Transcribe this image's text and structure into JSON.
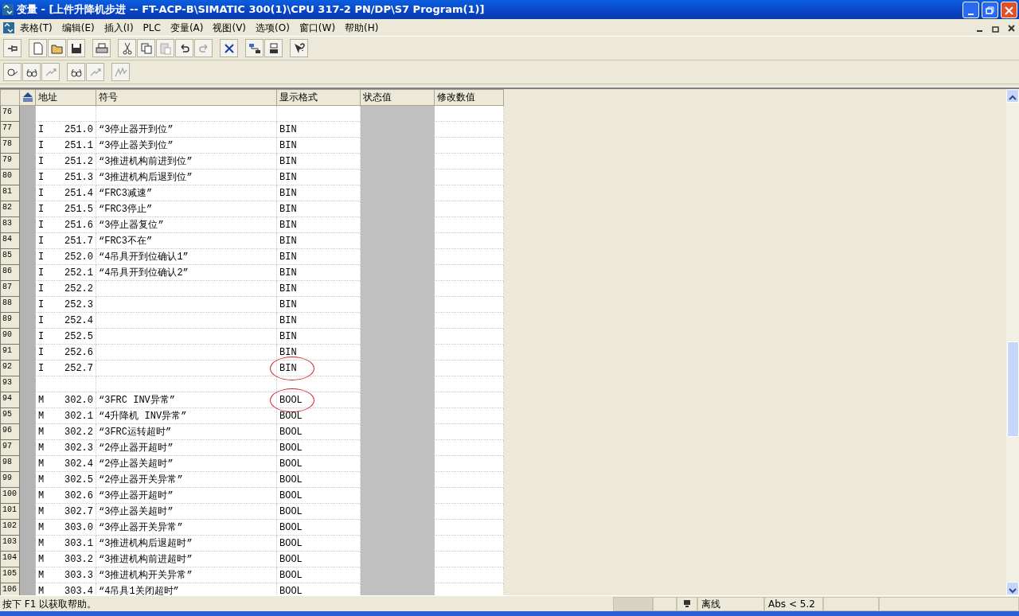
{
  "window": {
    "title": "变量 - [上件升降机步进 -- FT-ACP-B\\SIMATIC 300(1)\\CPU 317-2 PN/DP\\S7 Program(1)]"
  },
  "menu": [
    "表格(T)",
    "编辑(E)",
    "插入(I)",
    "PLC",
    "变量(A)",
    "视图(V)",
    "选项(O)",
    "窗口(W)",
    "帮助(H)"
  ],
  "toolbar1": [
    {
      "kind": "pin",
      "disabled": false
    },
    {
      "kind": "sep"
    },
    {
      "kind": "new",
      "disabled": false
    },
    {
      "kind": "open",
      "disabled": false
    },
    {
      "kind": "save",
      "disabled": false
    },
    {
      "kind": "sep"
    },
    {
      "kind": "print",
      "disabled": false
    },
    {
      "kind": "sep"
    },
    {
      "kind": "cut",
      "disabled": false
    },
    {
      "kind": "copy",
      "disabled": false
    },
    {
      "kind": "paste",
      "disabled": true
    },
    {
      "kind": "undo",
      "disabled": false
    },
    {
      "kind": "redo",
      "disabled": true
    },
    {
      "kind": "sep"
    },
    {
      "kind": "delete",
      "disabled": false
    },
    {
      "kind": "sep"
    },
    {
      "kind": "network",
      "disabled": false
    },
    {
      "kind": "station",
      "disabled": false
    },
    {
      "kind": "sep"
    },
    {
      "kind": "help",
      "disabled": false
    }
  ],
  "toolbar2": [
    {
      "kind": "monitor",
      "disabled": false
    },
    {
      "kind": "glasses",
      "disabled": false
    },
    {
      "kind": "trigger",
      "disabled": true
    },
    {
      "kind": "sep"
    },
    {
      "kind": "glasses",
      "disabled": false
    },
    {
      "kind": "trigger",
      "disabled": true
    },
    {
      "kind": "sep"
    },
    {
      "kind": "modify",
      "disabled": true
    }
  ],
  "table": {
    "columns": [
      "地址",
      "符号",
      "显示格式",
      "状态值",
      "修改数值"
    ],
    "rows": [
      {
        "n": "76",
        "area": "",
        "addr": "",
        "symbol": "",
        "format": "",
        "circled": false
      },
      {
        "n": "77",
        "area": "I",
        "addr": "251.0",
        "symbol": "“3停止器开到位”",
        "format": "BIN",
        "circled": false
      },
      {
        "n": "78",
        "area": "I",
        "addr": "251.1",
        "symbol": "“3停止器关到位”",
        "format": "BIN",
        "circled": false
      },
      {
        "n": "79",
        "area": "I",
        "addr": "251.2",
        "symbol": "“3推进机构前进到位”",
        "format": "BIN",
        "circled": false
      },
      {
        "n": "80",
        "area": "I",
        "addr": "251.3",
        "symbol": "“3推进机构后退到位”",
        "format": "BIN",
        "circled": false
      },
      {
        "n": "81",
        "area": "I",
        "addr": "251.4",
        "symbol": "“FRC3减速”",
        "format": "BIN",
        "circled": false
      },
      {
        "n": "82",
        "area": "I",
        "addr": "251.5",
        "symbol": "“FRC3停止”",
        "format": "BIN",
        "circled": false
      },
      {
        "n": "83",
        "area": "I",
        "addr": "251.6",
        "symbol": "“3停止器复位”",
        "format": "BIN",
        "circled": false
      },
      {
        "n": "84",
        "area": "I",
        "addr": "251.7",
        "symbol": "“FRC3不在”",
        "format": "BIN",
        "circled": false
      },
      {
        "n": "85",
        "area": "I",
        "addr": "252.0",
        "symbol": "“4吊具开到位确认1”",
        "format": "BIN",
        "circled": false
      },
      {
        "n": "86",
        "area": "I",
        "addr": "252.1",
        "symbol": "“4吊具开到位确认2”",
        "format": "BIN",
        "circled": false
      },
      {
        "n": "87",
        "area": "I",
        "addr": "252.2",
        "symbol": "",
        "format": "BIN",
        "circled": false
      },
      {
        "n": "88",
        "area": "I",
        "addr": "252.3",
        "symbol": "",
        "format": "BIN",
        "circled": false
      },
      {
        "n": "89",
        "area": "I",
        "addr": "252.4",
        "symbol": "",
        "format": "BIN",
        "circled": false
      },
      {
        "n": "90",
        "area": "I",
        "addr": "252.5",
        "symbol": "",
        "format": "BIN",
        "circled": false
      },
      {
        "n": "91",
        "area": "I",
        "addr": "252.6",
        "symbol": "",
        "format": "BIN",
        "circled": false
      },
      {
        "n": "92",
        "area": "I",
        "addr": "252.7",
        "symbol": "",
        "format": "BIN",
        "circled": true
      },
      {
        "n": "93",
        "area": "",
        "addr": "",
        "symbol": "",
        "format": "",
        "circled": false
      },
      {
        "n": "94",
        "area": "M",
        "addr": "302.0",
        "symbol": "“3FRC INV异常”",
        "format": "BOOL",
        "circled": true
      },
      {
        "n": "95",
        "area": "M",
        "addr": "302.1",
        "symbol": "“4升降机 INV异常”",
        "format": "BOOL",
        "circled": false
      },
      {
        "n": "96",
        "area": "M",
        "addr": "302.2",
        "symbol": "“3FRC运转超时”",
        "format": "BOOL",
        "circled": false
      },
      {
        "n": "97",
        "area": "M",
        "addr": "302.3",
        "symbol": "“2停止器开超时”",
        "format": "BOOL",
        "circled": false
      },
      {
        "n": "98",
        "area": "M",
        "addr": "302.4",
        "symbol": "“2停止器关超时”",
        "format": "BOOL",
        "circled": false
      },
      {
        "n": "99",
        "area": "M",
        "addr": "302.5",
        "symbol": "“2停止器开关异常”",
        "format": "BOOL",
        "circled": false
      },
      {
        "n": "100",
        "area": "M",
        "addr": "302.6",
        "symbol": "“3停止器开超时”",
        "format": "BOOL",
        "circled": false
      },
      {
        "n": "101",
        "area": "M",
        "addr": "302.7",
        "symbol": "“3停止器关超时”",
        "format": "BOOL",
        "circled": false
      },
      {
        "n": "102",
        "area": "M",
        "addr": "303.0",
        "symbol": "“3停止器开关异常”",
        "format": "BOOL",
        "circled": false
      },
      {
        "n": "103",
        "area": "M",
        "addr": "303.1",
        "symbol": "“3推进机构后退超时”",
        "format": "BOOL",
        "circled": false
      },
      {
        "n": "104",
        "area": "M",
        "addr": "303.2",
        "symbol": "“3推进机构前进超时”",
        "format": "BOOL",
        "circled": false
      },
      {
        "n": "105",
        "area": "M",
        "addr": "303.3",
        "symbol": "“3推进机构开关异常”",
        "format": "BOOL",
        "circled": false
      },
      {
        "n": "106",
        "area": "M",
        "addr": "303.4",
        "symbol": "“4吊具1关闭超时”",
        "format": "BOOL",
        "circled": false
      }
    ]
  },
  "status_bar": {
    "hint": "按下 F1 以获取帮助。",
    "mode": "离线",
    "version": "Abs < 5.2"
  }
}
